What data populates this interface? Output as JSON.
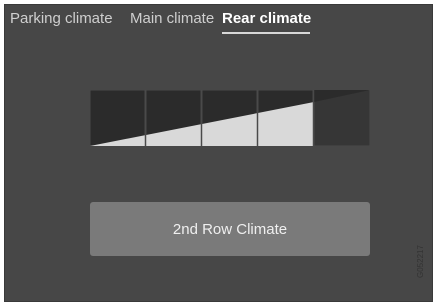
{
  "tabs": [
    {
      "label": "Parking climate",
      "active": false
    },
    {
      "label": "Main climate",
      "active": false
    },
    {
      "label": "Rear climate",
      "active": true
    }
  ],
  "level_indicator": {
    "total_segments": 5,
    "filled_segments": 4,
    "colors": {
      "segment_dark": "#2b2b2b",
      "segment_fill": "#d9d9d9",
      "segment_inactive": "#363636"
    }
  },
  "button": {
    "label": "2nd Row Climate"
  },
  "figure_code": "G052217",
  "colors": {
    "screen_bg": "#474747",
    "button_bg": "#7a7a7a",
    "tab_text": "#cfcfcf",
    "tab_active_text": "#ffffff"
  }
}
